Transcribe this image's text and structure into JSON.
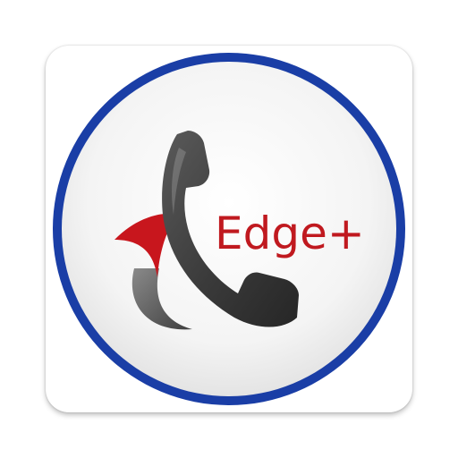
{
  "logo": {
    "wordmark": "Edge+",
    "colors": {
      "ring": "#1a3ea6",
      "disc": "#f3f3f3",
      "handset": "#3d3d3d",
      "accent_red": "#c8161d",
      "accent_gray": "#4b4b4b",
      "wordmark": "#c0191f"
    }
  }
}
